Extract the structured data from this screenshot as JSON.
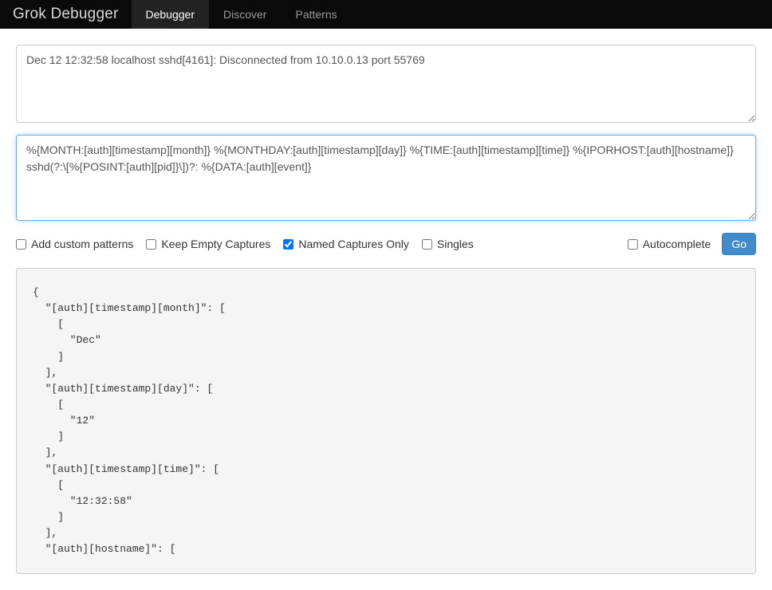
{
  "navbar": {
    "brand": "Grok Debugger",
    "tabs": [
      {
        "label": "Debugger",
        "active": true
      },
      {
        "label": "Discover",
        "active": false
      },
      {
        "label": "Patterns",
        "active": false
      }
    ]
  },
  "input": {
    "value": "Dec 12 12:32:58 localhost sshd[4161]: Disconnected from 10.10.0.13 port 55769"
  },
  "pattern": {
    "value": "%{MONTH:[auth][timestamp][month]} %{MONTHDAY:[auth][timestamp][day]} %{TIME:[auth][timestamp][time]} %{IPORHOST:[auth][hostname]} sshd(?:\\[%{POSINT:[auth][pid]}\\])?: %{DATA:[auth][event]}"
  },
  "options": {
    "add_custom_patterns": {
      "label": "Add custom patterns",
      "checked": false
    },
    "keep_empty_captures": {
      "label": "Keep Empty Captures",
      "checked": false
    },
    "named_captures_only": {
      "label": "Named Captures Only",
      "checked": true
    },
    "singles": {
      "label": "Singles",
      "checked": false
    },
    "autocomplete": {
      "label": "Autocomplete",
      "checked": false
    },
    "go_label": "Go"
  },
  "output": {
    "text": "{\n  \"[auth][timestamp][month]\": [\n    [\n      \"Dec\"\n    ]\n  ],\n  \"[auth][timestamp][day]\": [\n    [\n      \"12\"\n    ]\n  ],\n  \"[auth][timestamp][time]\": [\n    [\n      \"12:32:58\"\n    ]\n  ],\n  \"[auth][hostname]\": ["
  }
}
